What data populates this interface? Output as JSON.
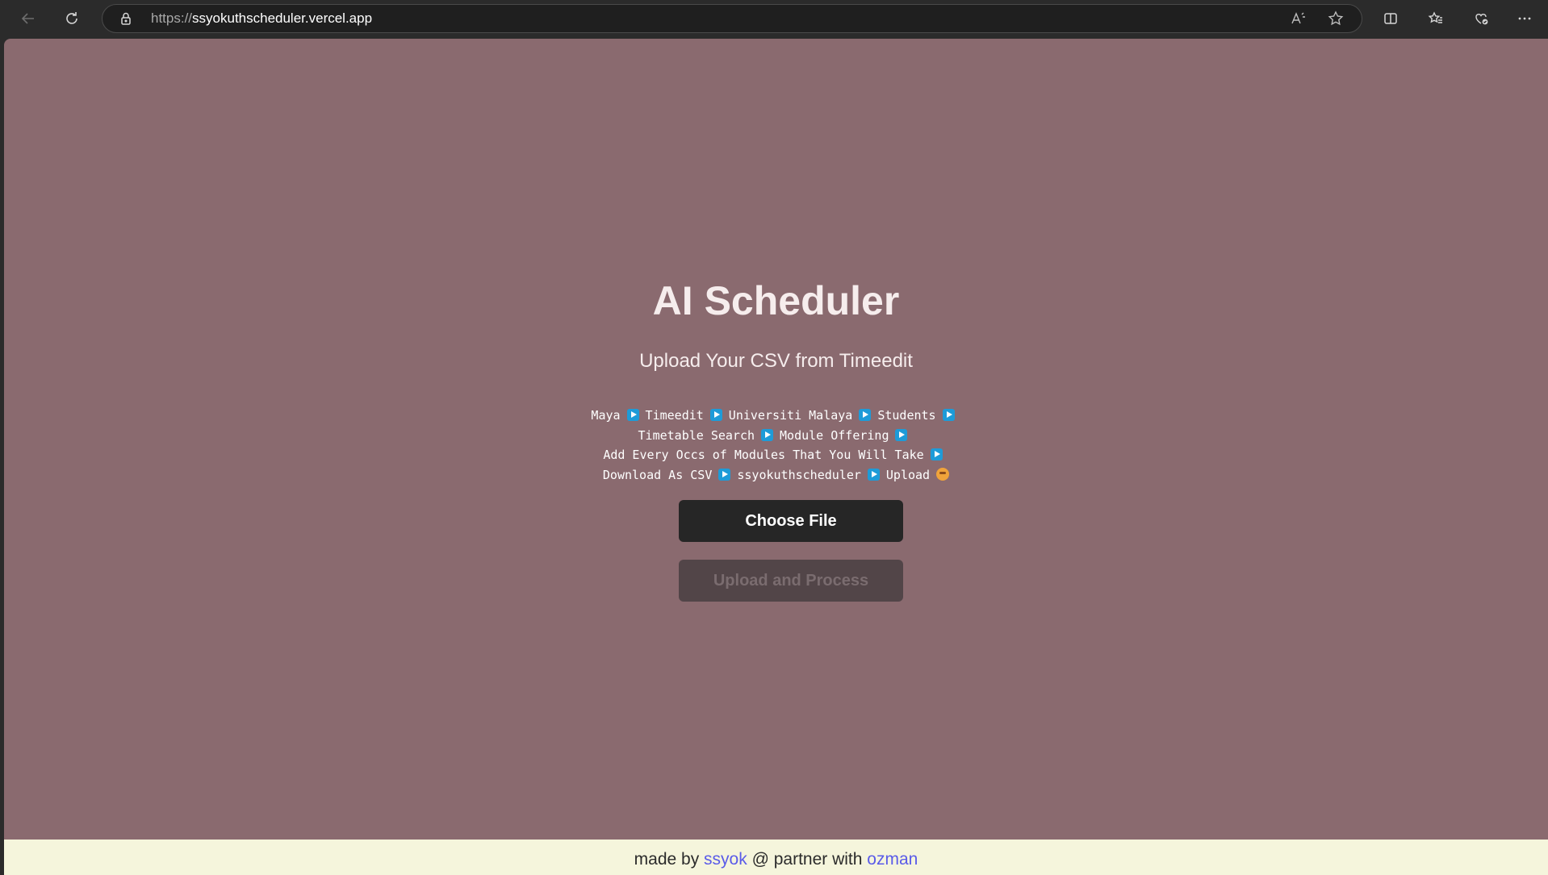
{
  "browser": {
    "url_scheme": "https://",
    "url_host": "ssyokuthscheduler.vercel.app"
  },
  "page": {
    "title": "AI Scheduler",
    "subtitle": "Upload Your CSV from Timeedit",
    "steps": [
      [
        "Maya",
        "Timeedit",
        "Universiti Malaya",
        "Students"
      ],
      [
        "Timetable Search",
        "Module Offering"
      ],
      [
        "Add Every Occs of Modules That You Will Take"
      ],
      [
        "Download As CSV",
        "ssyokuthscheduler",
        "Upload"
      ]
    ],
    "choose_file_label": "Choose File",
    "upload_label": "Upload and Process",
    "colors": {
      "background": "#8a6a6f",
      "primary_button": "#262626",
      "disabled_button": "#524548",
      "footer_bg": "#f5f5dc",
      "link": "#5a5be8",
      "arrow_badge": "#1d9bd8"
    }
  },
  "footer": {
    "made_by": "made by",
    "author": "ssyok",
    "partner_text": "@ partner with",
    "partner": "ozman"
  }
}
